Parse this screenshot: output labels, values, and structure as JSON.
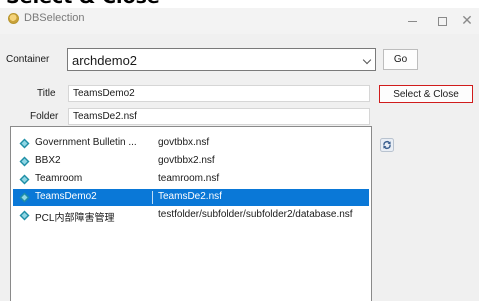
{
  "header": {
    "text": "Select & Close"
  },
  "window": {
    "title": "DBSelection",
    "app_icon": "notes-app-icon",
    "controls": [
      "minimize-icon",
      "maximize-icon",
      "close-icon"
    ],
    "close_glyph": "✕"
  },
  "form": {
    "container_label": "Container",
    "container_value": "archdemo2",
    "go_label": "Go",
    "title_label": "Title",
    "title_value": "TeamsDemo2",
    "folder_label": "Folder",
    "folder_value": "TeamsDe2.nsf",
    "select_close_label": "Select & Close"
  },
  "list": {
    "rows": [
      {
        "title": "Government Bulletin ...",
        "file": "govtbbx.nsf",
        "selected": false
      },
      {
        "title": "BBX2",
        "file": "govtbbx2.nsf",
        "selected": false
      },
      {
        "title": "Teamroom",
        "file": "teamroom.nsf",
        "selected": false
      },
      {
        "title": "TeamsDemo2",
        "file": "TeamsDe2.nsf",
        "selected": true
      },
      {
        "title": "PCL内部障害管理",
        "file": "testfolder/subfolder/subfolder2/database.nsf",
        "selected": false
      }
    ]
  },
  "icons": {
    "row_icon": "database-icon",
    "refresh": "refresh-icon"
  },
  "colors": {
    "selection": "#0a78d7",
    "highlight_border": "#d01c1c"
  }
}
